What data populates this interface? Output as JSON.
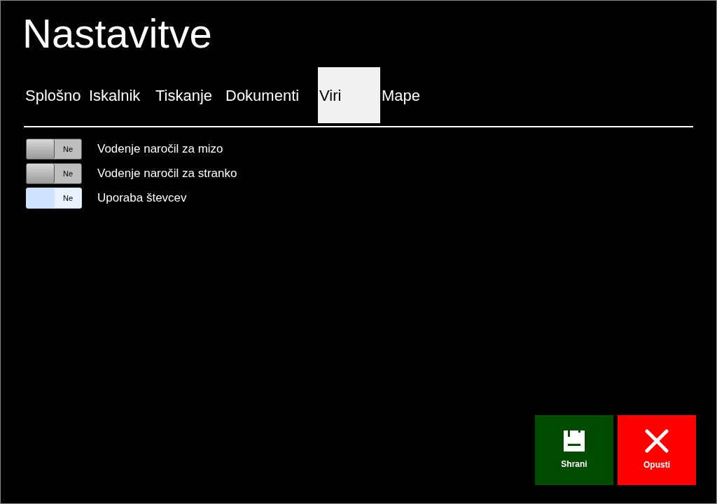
{
  "title": "Nastavitve",
  "tabs": [
    {
      "label": "Splošno",
      "selected": false
    },
    {
      "label": "Iskalnik",
      "selected": false
    },
    {
      "label": "Tiskanje",
      "selected": false
    },
    {
      "label": "Dokumenti",
      "selected": false
    },
    {
      "label": "Viri",
      "selected": true
    },
    {
      "label": "Mape",
      "selected": false
    }
  ],
  "settings": [
    {
      "toggle_label": "Ne",
      "on": false,
      "highlighted": false,
      "label": "Vodenje naročil za mizo"
    },
    {
      "toggle_label": "Ne",
      "on": false,
      "highlighted": false,
      "label": "Vodenje naročil za stranko"
    },
    {
      "toggle_label": "Ne",
      "on": false,
      "highlighted": true,
      "label": "Uporaba števcev"
    }
  ],
  "buttons": [
    {
      "kind": "save",
      "label": "Shrani"
    },
    {
      "kind": "cancel",
      "label": "Opusti"
    }
  ]
}
